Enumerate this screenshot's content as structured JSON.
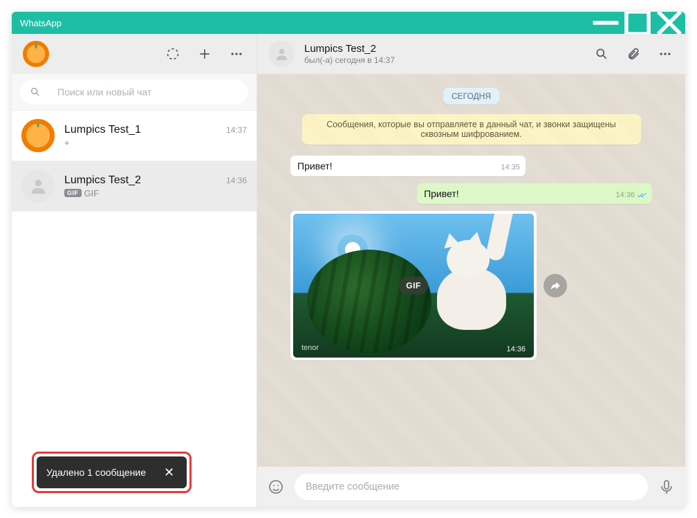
{
  "window": {
    "title": "WhatsApp"
  },
  "sidebar": {
    "search_placeholder": "Поиск или новый чат",
    "chats": [
      {
        "name": "Lumpics Test_1",
        "preview": "+",
        "time": "14:37",
        "avatar": "orange",
        "gif": false,
        "active": false
      },
      {
        "name": "Lumpics Test_2",
        "preview": "GIF",
        "time": "14:36",
        "avatar": "silhouette",
        "gif": true,
        "active": true
      }
    ]
  },
  "chat": {
    "contact_name": "Lumpics Test_2",
    "status": "был(-а) сегодня в 14:37",
    "date_label": "СЕГОДНЯ",
    "encryption_notice": "Сообщения, которые вы отправляете в данный чат, и звонки защищены сквозным шифрованием.",
    "messages": [
      {
        "type": "in",
        "text": "Привет!",
        "time": "14:35"
      },
      {
        "type": "out",
        "text": "Привет!",
        "time": "14:36"
      },
      {
        "type": "gif_in",
        "provider": "tenor",
        "gif_label": "GIF",
        "time": "14:36"
      }
    ],
    "composer_placeholder": "Введите сообщение"
  },
  "toast": {
    "text": "Удалено 1 сообщение"
  }
}
